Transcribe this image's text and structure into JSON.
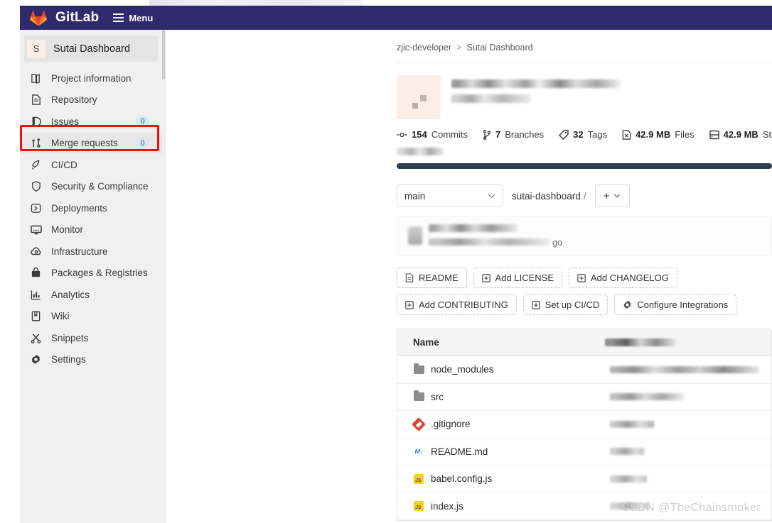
{
  "topbar": {
    "brand": "GitLab",
    "menu_label": "Menu",
    "brand_color": "#2f2a6b",
    "logo_color": "#e24329"
  },
  "sidebar": {
    "project": {
      "avatar_letter": "S",
      "name": "Sutai Dashboard"
    },
    "items": [
      {
        "label": "Project information",
        "icon": "project-information-icon",
        "badge": ""
      },
      {
        "label": "Repository",
        "icon": "repository-icon",
        "badge": ""
      },
      {
        "label": "Issues",
        "icon": "issues-icon",
        "badge": "0"
      },
      {
        "label": "Merge requests",
        "icon": "merge-requests-icon",
        "badge": "0"
      },
      {
        "label": "CI/CD",
        "icon": "ci-cd-icon",
        "badge": ""
      },
      {
        "label": "Security & Compliance",
        "icon": "shield-icon",
        "badge": ""
      },
      {
        "label": "Deployments",
        "icon": "deployments-icon",
        "badge": ""
      },
      {
        "label": "Monitor",
        "icon": "monitor-icon",
        "badge": ""
      },
      {
        "label": "Infrastructure",
        "icon": "cloud-icon",
        "badge": ""
      },
      {
        "label": "Packages & Registries",
        "icon": "package-icon",
        "badge": ""
      },
      {
        "label": "Analytics",
        "icon": "analytics-icon",
        "badge": ""
      },
      {
        "label": "Wiki",
        "icon": "book-icon",
        "badge": ""
      },
      {
        "label": "Snippets",
        "icon": "scissors-icon",
        "badge": ""
      },
      {
        "label": "Settings",
        "icon": "gear-icon",
        "badge": ""
      }
    ],
    "highlight": {
      "target_label": "Merge requests",
      "color": "#f40f0f"
    }
  },
  "breadcrumb": {
    "group": "zjic-developer",
    "separator": ">",
    "project": "Sutai Dashboard"
  },
  "stats": [
    {
      "icon": "commit-icon",
      "value": "154",
      "label": "Commits"
    },
    {
      "icon": "branch-icon",
      "value": "7",
      "label": "Branches"
    },
    {
      "icon": "tag-icon",
      "value": "32",
      "label": "Tags"
    },
    {
      "icon": "files-icon",
      "value": "42.9 MB",
      "label": "Files"
    },
    {
      "icon": "storage-icon",
      "value": "42.9 MB",
      "label": "Storage"
    }
  ],
  "language_bar_color": "#2c3e50",
  "branch_bar": {
    "branch": "main",
    "path": "sutai-dashboard",
    "path_separator": "/",
    "add_label": "+"
  },
  "last_commit": {
    "time_ago_suffix": "go"
  },
  "actions": [
    {
      "label": "README",
      "icon": "file-icon",
      "style": "solid"
    },
    {
      "label": "Add LICENSE",
      "icon": "plus-box-icon",
      "style": "dashed"
    },
    {
      "label": "Add CHANGELOG",
      "icon": "plus-box-icon",
      "style": "dashed"
    },
    {
      "label": "Add CONTRIBUTING",
      "icon": "plus-box-icon",
      "style": "dashed"
    },
    {
      "label": "Set up CI/CD",
      "icon": "plus-box-icon",
      "style": "dashed"
    },
    {
      "label": "Configure Integrations",
      "icon": "gear-icon",
      "style": "dashed"
    }
  ],
  "file_table": {
    "columns": [
      "Name"
    ],
    "rows": [
      {
        "name": "node_modules",
        "icon": "folder-icon"
      },
      {
        "name": "src",
        "icon": "folder-icon"
      },
      {
        "name": ".gitignore",
        "icon": "git-icon"
      },
      {
        "name": "README.md",
        "icon": "markdown-icon"
      },
      {
        "name": "babel.config.js",
        "icon": "javascript-icon"
      },
      {
        "name": "index.js",
        "icon": "javascript-icon"
      }
    ]
  },
  "watermark": "CSDN @TheChainsmoker"
}
